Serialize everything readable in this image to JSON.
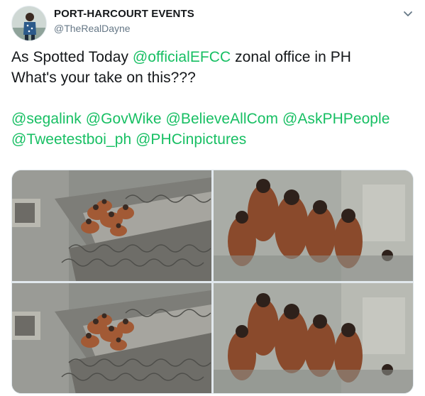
{
  "account": {
    "display_name": "PORT-HARCOURT EVENTS",
    "handle": "@TheRealDayne"
  },
  "tweet": {
    "line1_prefix": "As Spotted Today ",
    "line1_mention": "@officialEFCC",
    "line1_suffix": " zonal office in PH",
    "line2": "What's your take on this???",
    "mentions_line1": [
      "@segalink",
      "@GovWike",
      "@BelieveAllCom",
      "@AskPHPeople"
    ],
    "mentions_line2": [
      "@Tweetestboi_ph",
      "@PHCinpictures"
    ]
  },
  "media": {
    "photos": [
      {
        "icon": "photo-rooftop-crowd"
      },
      {
        "icon": "photo-closeup-crowd"
      },
      {
        "icon": "photo-rooftop-crowd"
      },
      {
        "icon": "photo-closeup-crowd"
      }
    ]
  },
  "colors": {
    "mention": "#17bf63",
    "text": "#14171a",
    "secondary": "#657786"
  },
  "icons": {
    "caret": "chevron-down-icon"
  }
}
